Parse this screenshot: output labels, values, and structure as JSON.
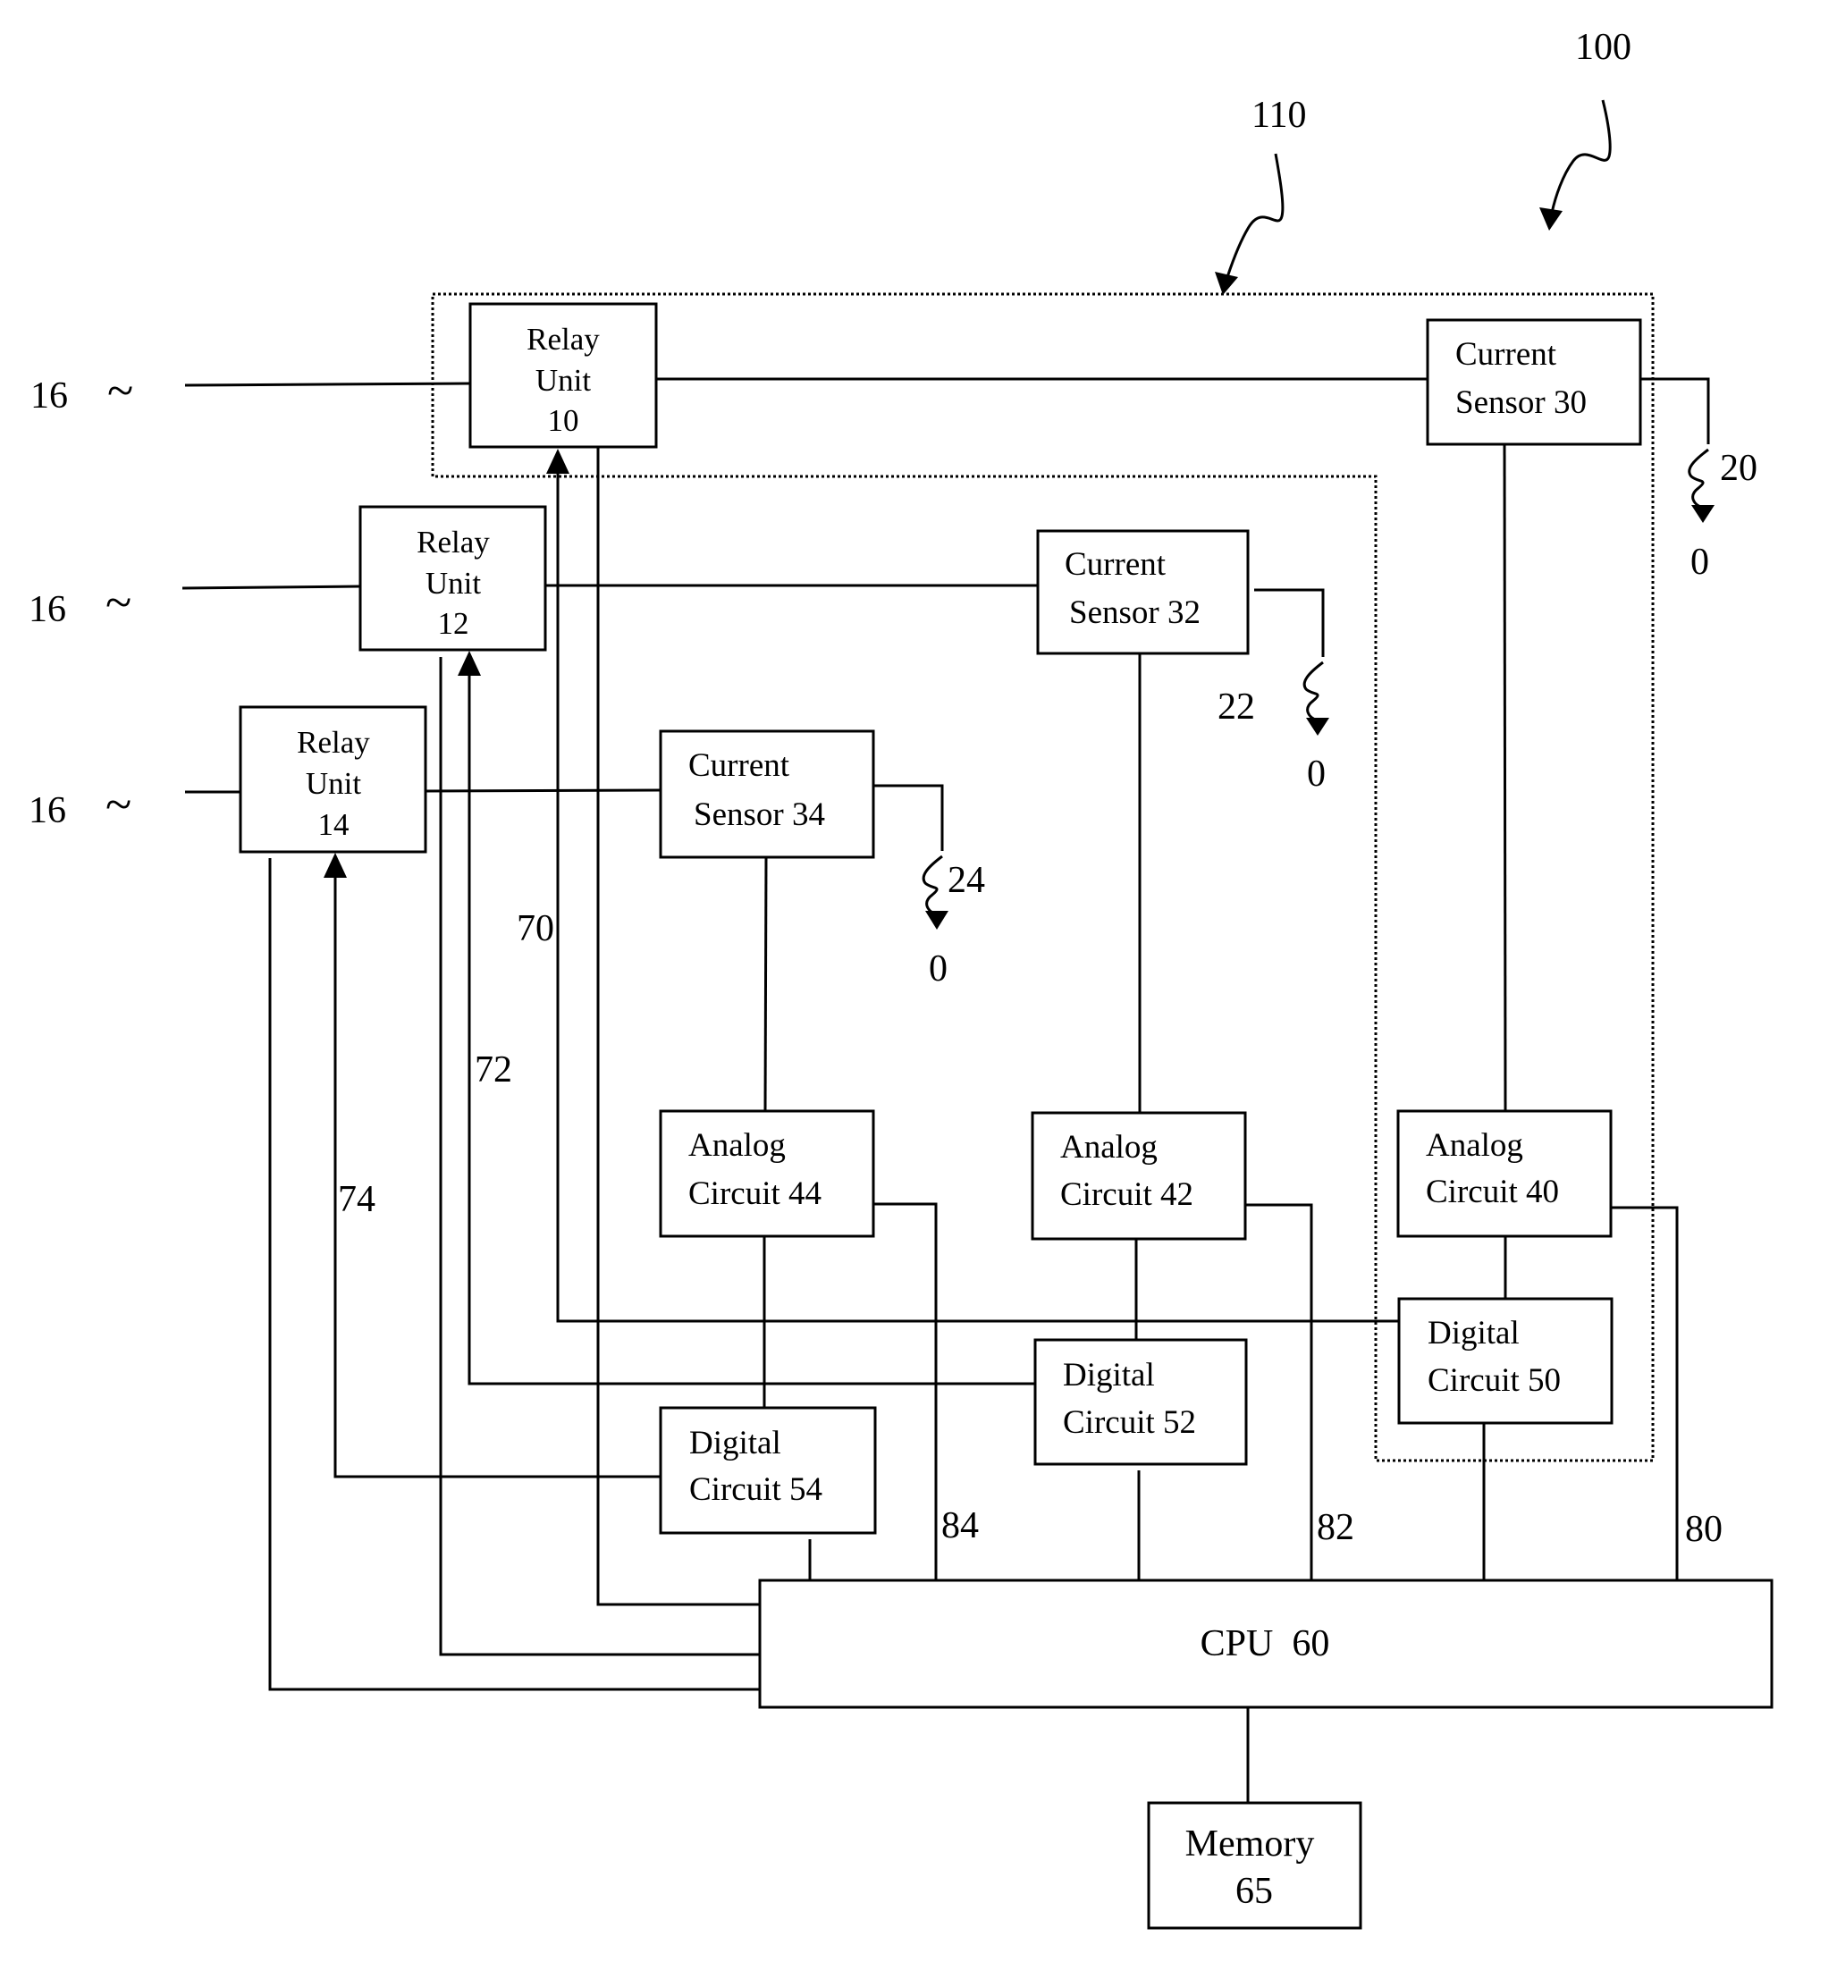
{
  "figure": {
    "system_ref": "100",
    "module_ref": "110"
  },
  "inputs": [
    {
      "ref": "16",
      "symbol": "~"
    },
    {
      "ref": "16",
      "symbol": "~"
    },
    {
      "ref": "16",
      "symbol": "~"
    }
  ],
  "relays": [
    {
      "line1": "Relay",
      "line2": "Unit",
      "line3": "10"
    },
    {
      "line1": "Relay",
      "line2": "Unit",
      "line3": "12"
    },
    {
      "line1": "Relay",
      "line2": "Unit",
      "line3": "14"
    }
  ],
  "sensors": [
    {
      "line1": "Current",
      "line2": "Sensor 30",
      "load_ref": "20",
      "ground": "0"
    },
    {
      "line1": "Current",
      "line2": "Sensor 32",
      "load_ref": "22",
      "ground": "0"
    },
    {
      "line1": "Current",
      "line2": "Sensor 34",
      "load_ref": "24",
      "ground": "0"
    }
  ],
  "analog": [
    {
      "line1": "Analog",
      "line2": "Circuit 40"
    },
    {
      "line1": "Analog",
      "line2": "Circuit 42"
    },
    {
      "line1": "Analog",
      "line2": "Circuit 44"
    }
  ],
  "digital": [
    {
      "line1": "Digital",
      "line2": "Circuit 50"
    },
    {
      "line1": "Digital",
      "line2": "Circuit 52"
    },
    {
      "line1": "Digital",
      "line2": "Circuit 54"
    }
  ],
  "control_lines": [
    "70",
    "72",
    "74"
  ],
  "signal_lines": [
    "80",
    "82",
    "84"
  ],
  "cpu": {
    "label": "CPU  60"
  },
  "memory": {
    "line1": "Memory",
    "line2": "65"
  }
}
